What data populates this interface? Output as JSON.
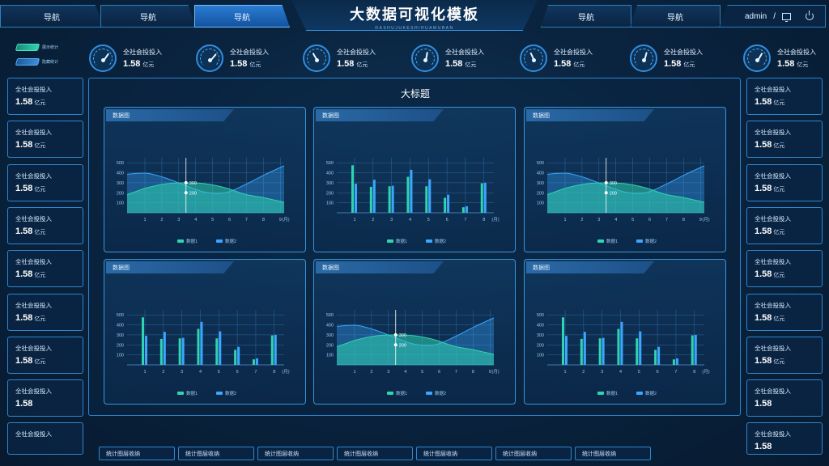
{
  "header": {
    "title": "大数据可视化模板",
    "subtitle": "DASHUJUKESHIHUAMUBAN",
    "nav_left": [
      "导航",
      "导航",
      "导航"
    ],
    "nav_right": [
      "导航",
      "导航"
    ],
    "username": "admin",
    "separator": "/"
  },
  "toggles": [
    {
      "label": "展示统计",
      "color": "#2fd4b0"
    },
    {
      "label": "隐藏统计",
      "color": "#3a8fe0"
    }
  ],
  "gauges": [
    {
      "label": "全社会投投入",
      "value": "1.58",
      "unit": "亿元"
    },
    {
      "label": "全社会投投入",
      "value": "1.58",
      "unit": "亿元"
    },
    {
      "label": "全社会投投入",
      "value": "1.58",
      "unit": "亿元"
    },
    {
      "label": "全社会投投入",
      "value": "1.58",
      "unit": "亿元"
    },
    {
      "label": "全社会投投入",
      "value": "1.58",
      "unit": "亿元"
    },
    {
      "label": "全社会投投入",
      "value": "1.58",
      "unit": "亿元"
    },
    {
      "label": "全社会投投入",
      "value": "1.58",
      "unit": "亿元"
    }
  ],
  "left_cards": [
    {
      "label": "全社会投投入",
      "value": "1.58",
      "unit": "亿元"
    },
    {
      "label": "全社会投投入",
      "value": "1.58",
      "unit": "亿元"
    },
    {
      "label": "全社会投投入",
      "value": "1.58",
      "unit": "亿元"
    },
    {
      "label": "全社会投投入",
      "value": "1.58",
      "unit": "亿元"
    },
    {
      "label": "全社会投投入",
      "value": "1.58",
      "unit": "亿元"
    },
    {
      "label": "全社会投投入",
      "value": "1.58",
      "unit": "亿元"
    },
    {
      "label": "全社会投投入",
      "value": "1.58",
      "unit": "亿元"
    },
    {
      "label": "全社会投投入",
      "value": "1.58",
      "unit": ""
    },
    {
      "label": "全社会投投入",
      "value": "",
      "unit": ""
    }
  ],
  "right_cards": [
    {
      "label": "全社会投投入",
      "value": "1.58",
      "unit": "亿元"
    },
    {
      "label": "全社会投投入",
      "value": "1.58",
      "unit": "亿元"
    },
    {
      "label": "全社会投投入",
      "value": "1.58",
      "unit": "亿元"
    },
    {
      "label": "全社会投投入",
      "value": "1.58",
      "unit": "亿元"
    },
    {
      "label": "全社会投投入",
      "value": "1.58",
      "unit": "亿元"
    },
    {
      "label": "全社会投投入",
      "value": "1.58",
      "unit": "亿元"
    },
    {
      "label": "全社会投投入",
      "value": "1.58",
      "unit": "亿元"
    },
    {
      "label": "全社会投投入",
      "value": "1.58",
      "unit": ""
    },
    {
      "label": "全社会投投入",
      "value": "1.58",
      "unit": ""
    }
  ],
  "main": {
    "title": "大标题"
  },
  "bottom_buttons": [
    "统计图层收纳",
    "统计图层收纳",
    "统计图层收纳",
    "统计图层收纳",
    "统计图层收纳",
    "统计图层收纳",
    "统计图层收纳"
  ],
  "colors": {
    "series1": "#2fd4b0",
    "series2": "#3aa6ff",
    "accent": "#2f86cf"
  },
  "chart_data": [
    {
      "type": "area",
      "header": "数据图",
      "x": [
        1,
        2,
        3,
        4,
        5,
        6,
        7,
        8,
        9
      ],
      "x_unit": "(月)",
      "y_ticks": [
        100,
        200,
        300,
        400,
        500
      ],
      "ylim": [
        0,
        550
      ],
      "series": [
        {
          "name": "数据1",
          "values": [
            180,
            250,
            290,
            300,
            290,
            250,
            185,
            150,
            105
          ]
        },
        {
          "name": "数据2",
          "values": [
            385,
            395,
            345,
            270,
            205,
            200,
            280,
            380,
            470
          ]
        }
      ],
      "marker": {
        "x": 4,
        "labels": [
          "300",
          "200"
        ]
      }
    },
    {
      "type": "bar",
      "header": "数据图",
      "x": [
        1,
        2,
        3,
        4,
        5,
        6,
        7,
        8
      ],
      "x_unit": "(月)",
      "y_ticks": [
        100,
        200,
        300,
        400,
        500
      ],
      "ylim": [
        0,
        550
      ],
      "series": [
        {
          "name": "数据1",
          "values": [
            475,
            260,
            265,
            360,
            265,
            150,
            55,
            295
          ]
        },
        {
          "name": "数据2",
          "values": [
            290,
            330,
            270,
            430,
            335,
            180,
            65,
            300
          ]
        }
      ]
    },
    {
      "type": "area",
      "header": "数据图",
      "x": [
        1,
        2,
        3,
        4,
        5,
        6,
        7,
        8,
        9
      ],
      "x_unit": "(月)",
      "y_ticks": [
        100,
        200,
        300,
        400,
        500
      ],
      "ylim": [
        0,
        550
      ],
      "series": [
        {
          "name": "数据1",
          "values": [
            180,
            250,
            290,
            300,
            290,
            250,
            185,
            150,
            105
          ]
        },
        {
          "name": "数据2",
          "values": [
            385,
            395,
            345,
            270,
            205,
            200,
            280,
            380,
            470
          ]
        }
      ],
      "marker": {
        "x": 4,
        "labels": [
          "300",
          "200"
        ]
      }
    },
    {
      "type": "bar",
      "header": "数据图",
      "x": [
        1,
        2,
        3,
        4,
        5,
        6,
        7,
        8
      ],
      "x_unit": "(月)",
      "y_ticks": [
        100,
        200,
        300,
        400,
        500
      ],
      "ylim": [
        0,
        550
      ],
      "series": [
        {
          "name": "数据1",
          "values": [
            475,
            260,
            265,
            360,
            265,
            150,
            55,
            295
          ]
        },
        {
          "name": "数据2",
          "values": [
            290,
            330,
            270,
            430,
            335,
            180,
            65,
            300
          ]
        }
      ]
    },
    {
      "type": "area",
      "header": "数据图",
      "x": [
        1,
        2,
        3,
        4,
        5,
        6,
        7,
        8,
        9
      ],
      "x_unit": "(月)",
      "y_ticks": [
        100,
        200,
        300,
        400,
        500
      ],
      "ylim": [
        0,
        550
      ],
      "series": [
        {
          "name": "数据1",
          "values": [
            180,
            250,
            290,
            300,
            290,
            250,
            185,
            150,
            105
          ]
        },
        {
          "name": "数据2",
          "values": [
            385,
            395,
            345,
            270,
            205,
            200,
            280,
            380,
            470
          ]
        }
      ],
      "marker": {
        "x": 4,
        "labels": [
          "300",
          "200"
        ]
      }
    },
    {
      "type": "bar",
      "header": "数据图",
      "x": [
        1,
        2,
        3,
        4,
        5,
        6,
        7,
        8
      ],
      "x_unit": "(月)",
      "y_ticks": [
        100,
        200,
        300,
        400,
        500
      ],
      "ylim": [
        0,
        550
      ],
      "series": [
        {
          "name": "数据1",
          "values": [
            475,
            260,
            265,
            360,
            265,
            150,
            55,
            295
          ]
        },
        {
          "name": "数据2",
          "values": [
            290,
            330,
            270,
            430,
            335,
            180,
            65,
            300
          ]
        }
      ]
    }
  ]
}
